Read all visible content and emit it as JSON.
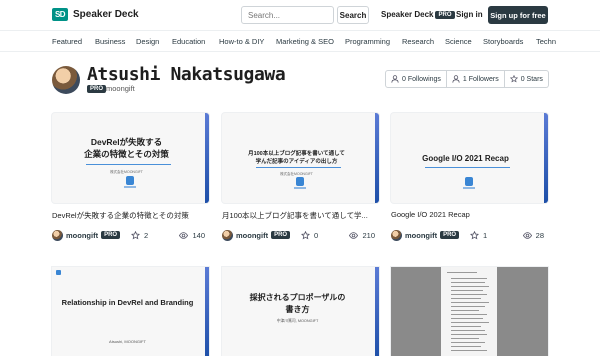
{
  "header": {
    "logo_mark": "SD",
    "logo_text": "Speaker Deck",
    "search_placeholder": "Search...",
    "search_button": "Search",
    "sd_pro_label": "Speaker Deck",
    "pro_badge": "PRO",
    "signin": "Sign in",
    "signup": "Sign up for free"
  },
  "categories": [
    "Featured",
    "Business",
    "Design",
    "Education",
    "How-to & DIY",
    "Marketing & SEO",
    "Programming",
    "Research",
    "Science",
    "Storyboards",
    "Techn"
  ],
  "profile": {
    "name": "Atsushi Nakatsugawa",
    "pro_badge": "PRO",
    "username": "moongift",
    "followings": "0 Followings",
    "followers": "1 Followers",
    "stars": "0 Stars"
  },
  "decks": [
    {
      "thumb_line1": "DevRelが失敗する",
      "thumb_line2": "企業の特徴とその対策",
      "thumb_sub": "株式会社MOONGIFT",
      "title": "DevRelが失敗する企業の特徴とその対策",
      "author": "moongift",
      "pro": "PRO",
      "stars": "2",
      "views": "140"
    },
    {
      "thumb_line1": "月100本以上ブログ記事を書いて通して",
      "thumb_line2": "学んだ記事のアイディアの出し方",
      "thumb_sub": "株式会社MOONGIFT",
      "title": "月100本以上ブログ記事を書いて通して学...",
      "author": "moongift",
      "pro": "PRO",
      "stars": "0",
      "views": "210"
    },
    {
      "thumb_line1": "Google I/O 2021 Recap",
      "thumb_line2": "",
      "thumb_sub": "",
      "title": "Google I/O 2021 Recap",
      "author": "moongift",
      "pro": "PRO",
      "stars": "1",
      "views": "28"
    }
  ],
  "bottom_decks": [
    {
      "headline": "Relationship in DevRel and Branding",
      "sub": "Atsushi, MOONGIFT"
    },
    {
      "headline_line1": "採択されるプロポーザルの",
      "headline_line2": "書き方",
      "sub": "中津川篤司, MOONGIFT"
    }
  ]
}
